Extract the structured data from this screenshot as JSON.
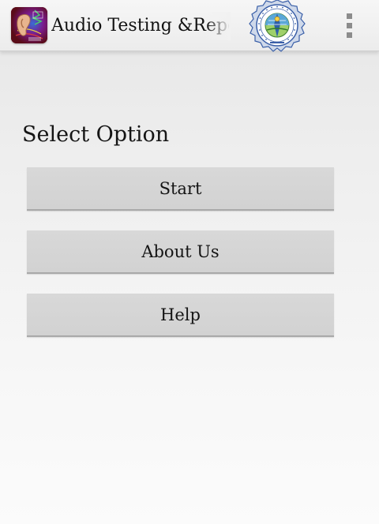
{
  "action_bar": {
    "title": "Audio Testing &Repell",
    "app_icon": "ear-icon",
    "logo": "institution-seal-logo",
    "menu_icon": "overflow-menu-icon"
  },
  "main": {
    "section_label": "Select Option",
    "buttons": {
      "start": "Start",
      "about": "About Us",
      "help": "Help"
    }
  },
  "colors": {
    "background": "#eeeeee",
    "action_bar": "#f0f0f0",
    "button": "#d5d5d5",
    "text": "#141414",
    "menu_icon": "#8c8c8c"
  }
}
